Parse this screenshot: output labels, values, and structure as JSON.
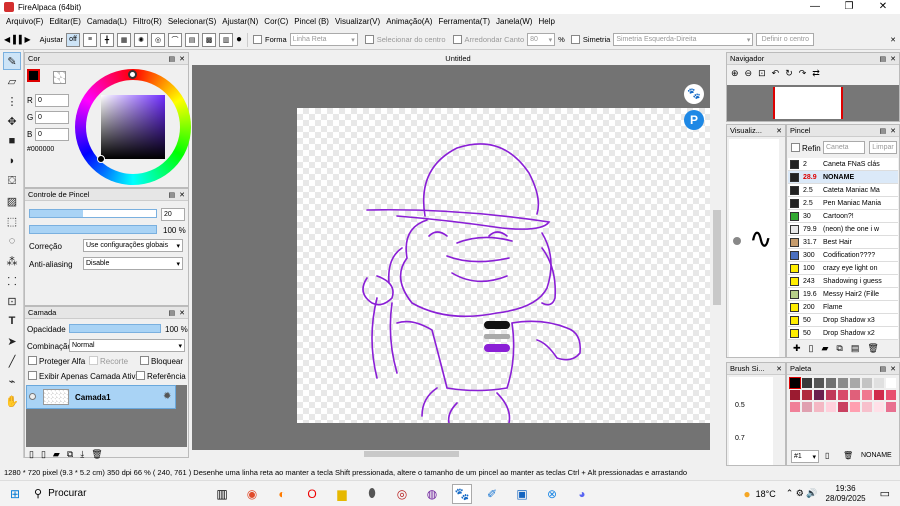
{
  "window": {
    "title": "FireAlpaca (64bit)",
    "min": "—",
    "max": "❐",
    "close": "✕"
  },
  "menu": [
    "Arquivo(F)",
    "Editar(E)",
    "Camada(L)",
    "Filtro(R)",
    "Selecionar(S)",
    "Ajustar(N)",
    "Cor(C)",
    "Pincel (B)",
    "Visualizar(V)",
    "Animação(A)",
    "Ferramenta(T)",
    "Janela(W)",
    "Help"
  ],
  "toolbar": {
    "ajustar": "Ajustar",
    "off": "off",
    "forma": "Forma",
    "forma_value": "Linha Reta",
    "centro": "Selecionar do centro",
    "arredondar": "Arredondar Canto",
    "arredondar_value": "80",
    "pct": "%",
    "simetria": "Simetria",
    "simetria_value": "Simetria Esquerda-Direita",
    "definir": "Definir o centro"
  },
  "color_panel": {
    "title": "Cor",
    "r_label": "R",
    "r": "0",
    "g_label": "G",
    "g": "0",
    "b_label": "B",
    "b": "0",
    "hex": "#000000"
  },
  "brush_control": {
    "title": "Controle de Pincel",
    "size": "20",
    "opacity": "100 %",
    "correction_label": "Correção",
    "correction_value": "Use configurações globais",
    "aa_label": "Anti-aliasing",
    "aa_value": "Disable"
  },
  "layer_panel": {
    "title": "Camada",
    "opacity_label": "Opacidade",
    "opacity_value": "100 %",
    "blend_label": "Combinação",
    "blend_value": "Normal",
    "protect": "Proteger Alfa",
    "clip": "Recorte",
    "lock": "Bloquear",
    "show_active": "Exibir Apenas Camada Ativa",
    "reference": "Referência",
    "layer_name": "Camada1",
    "opacity_fraction": 1.0
  },
  "canvas": {
    "tab": "Untitled"
  },
  "navigator": {
    "title": "Navigador"
  },
  "visualizer": {
    "title": "Visualiz..."
  },
  "brush_panel": {
    "title": "Pincel",
    "refin": "Refin",
    "search_placeholder": "Caneta",
    "clear": "Limpar",
    "items": [
      {
        "size": "2",
        "name": "Caneta FNaS clás",
        "color": "#222222"
      },
      {
        "size": "28.9",
        "name": "NONAME",
        "color": "#222222",
        "selected": true
      },
      {
        "size": "2.5",
        "name": "Cateta Maniac Ma",
        "color": "#222222"
      },
      {
        "size": "2.5",
        "name": "Pen Maniac Mania",
        "color": "#222222"
      },
      {
        "size": "30",
        "name": "Cartoon?!",
        "color": "#33aa33"
      },
      {
        "size": "79.9",
        "name": "(neon) the one i w",
        "color": "#e8e8e8"
      },
      {
        "size": "31.7",
        "name": "Best Hair",
        "color": "#c69c6d"
      },
      {
        "size": "300",
        "name": "Codification????",
        "color": "#4a6fbf"
      },
      {
        "size": "100",
        "name": "crazy eye light on",
        "color": "#ffee00"
      },
      {
        "size": "243",
        "name": "Shadowing i guess",
        "color": "#ffee00"
      },
      {
        "size": "19.6",
        "name": "Messy Hair2 (Fille",
        "color": "#b8d08a"
      },
      {
        "size": "200",
        "name": "Flame",
        "color": "#ffee00"
      },
      {
        "size": "50",
        "name": "Drop Shadow x3",
        "color": "#ffee00"
      },
      {
        "size": "50",
        "name": "Drop Shadow x2",
        "color": "#ffee00"
      }
    ]
  },
  "brush_size_panel": {
    "title": "Brush Si...",
    "values": [
      "0.5",
      "0.7"
    ]
  },
  "palette": {
    "title": "Paleta",
    "index": "#1",
    "name": "NONAME",
    "colors": [
      "#000000",
      "#3a3a3a",
      "#555555",
      "#707070",
      "#8c8c8c",
      "#a8a8a8",
      "#c4c4c4",
      "#e0e0e0",
      "#ffffff",
      "#9b1b30",
      "#b02a3e",
      "#6b1f4e",
      "#c0395a",
      "#d84a6a",
      "#e0607a",
      "#f07890",
      "#d02b4b",
      "#e85070",
      "#f08098",
      "#e0a0b0",
      "#f4b8c4",
      "#ffd0dc",
      "#c94060",
      "#ff9fb0",
      "#f7c0cc",
      "#ffe0e8",
      "#e87090"
    ]
  },
  "status": {
    "text": "1280 * 720 pixel   (9.3 * 5.2 cm)   350 dpi   66 %   ( 240, 761 )   Desenhe uma linha reta ao manter a tecla Shift pressionada, altere o tamanho de um pincel ao manter as teclas Ctrl + Alt pressionadas e arrastando"
  },
  "taskbar": {
    "search": "Procurar",
    "temp": "18°C",
    "time": "19:36",
    "date": "28/09/2025"
  }
}
